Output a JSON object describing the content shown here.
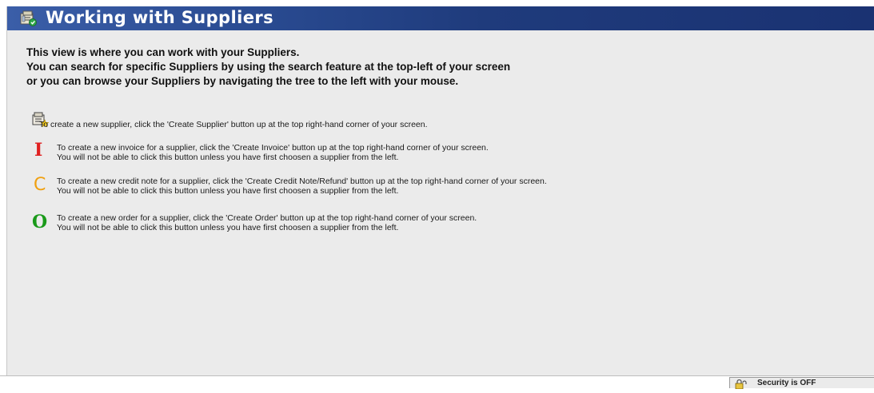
{
  "header": {
    "title": "Working with Suppliers",
    "icon": "suppliers-icon"
  },
  "intro": {
    "line1": "This view is where you can work with your Suppliers.",
    "line2": "You can search for specific Suppliers by using the search feature at the top-left of your screen",
    "line3": "or you can browse your Suppliers by navigating the tree to the left with your mouse."
  },
  "tips": {
    "supplier": {
      "icon": "create-supplier-icon",
      "line1": "To create a new supplier, click the 'Create Supplier' button up at the top right-hand corner of your screen."
    },
    "invoice": {
      "letter": "I",
      "color": "#e02020",
      "line1": "To create a new invoice for a supplier, click the 'Create Invoice' button up at the top right-hand corner of your screen.",
      "line2": "You will not be able to click this button unless you have first choosen a supplier from the left."
    },
    "credit": {
      "letter": "C",
      "color": "#f0a010",
      "line1": "To create a new credit note for a supplier, click the 'Create Credit Note/Refund' button up at the top right-hand corner of your screen.",
      "line2": "You will not be able to click this button unless you have first choosen a supplier from the left."
    },
    "order": {
      "letter": "O",
      "color": "#1a9a1a",
      "line1": "To create a new order for a supplier, click the 'Create Order' button up at the top right-hand corner of your screen.",
      "line2": "You will not be able to click this button unless you have first choosen a supplier from the left."
    }
  },
  "status": {
    "security": "Security is OFF",
    "icon": "lock-icon"
  }
}
